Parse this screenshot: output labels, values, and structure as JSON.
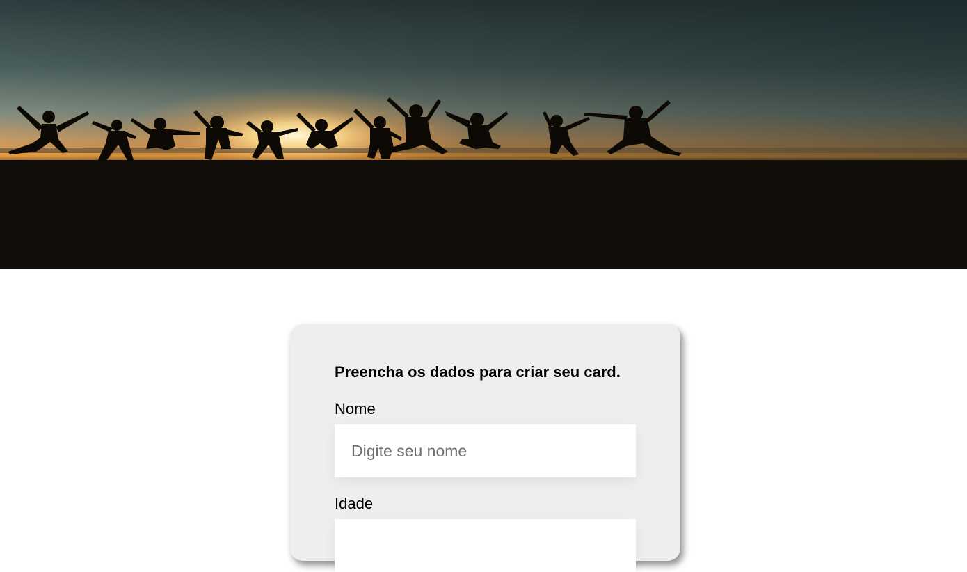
{
  "hero": {
    "image": "sunset-beach-jumping-silhouettes"
  },
  "form": {
    "title": "Preencha os dados para criar seu card.",
    "fields": [
      {
        "label": "Nome",
        "placeholder": "Digite seu nome",
        "value": ""
      },
      {
        "label": "Idade",
        "placeholder": "",
        "value": ""
      }
    ]
  },
  "colors": {
    "card_background": "#eeeeee",
    "input_background": "#ffffff",
    "page_background": "#ffffff"
  }
}
